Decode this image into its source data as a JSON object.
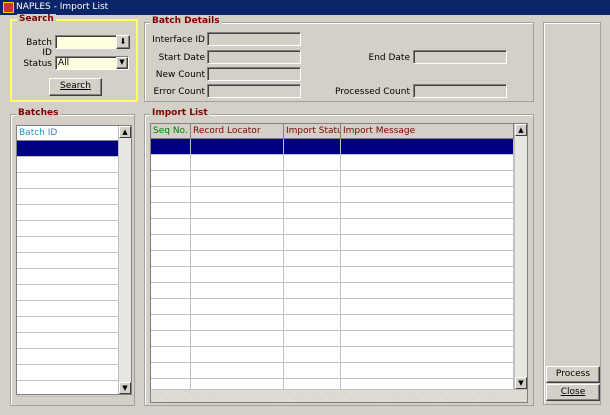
{
  "window": {
    "title": "NAPLES - Import List",
    "icon": "app-icon"
  },
  "search": {
    "group_label": "Search",
    "batch_id_label": "Batch ID",
    "batch_id_value": "",
    "status_label": "Status",
    "status_value": "All",
    "search_button": "Search"
  },
  "batch_details": {
    "group_label": "Batch Details",
    "interface_id_label": "Interface ID",
    "start_date_label": "Start Date",
    "new_count_label": "New Count",
    "error_count_label": "Error Count",
    "end_date_label": "End Date",
    "processed_count_label": "Processed Count",
    "interface_id": "",
    "start_date": "",
    "new_count": "",
    "error_count": "",
    "end_date": "",
    "processed_count": ""
  },
  "batches": {
    "group_label": "Batches",
    "column": "Batch ID",
    "rows": []
  },
  "import_list": {
    "group_label": "Import List",
    "columns": [
      "Seq No.",
      "Record Locator",
      "Import Status",
      "Import Message"
    ],
    "rows": []
  },
  "actions": {
    "process": "Process",
    "close": "Close"
  },
  "colors": {
    "selection": "#000080",
    "group_label": "#800000",
    "seq_header": "#008000",
    "batch_header": "#1e90c8",
    "search_highlight": "#ffff66"
  }
}
